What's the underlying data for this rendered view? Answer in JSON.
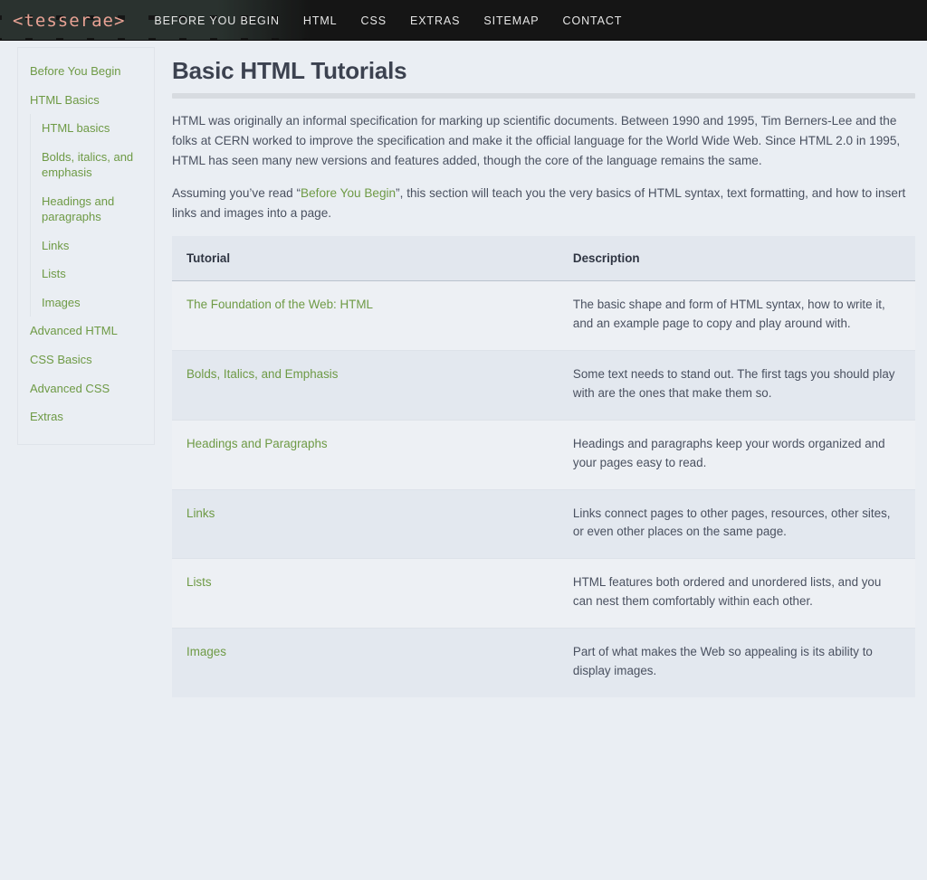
{
  "header": {
    "brand": "<tesserae>",
    "nav": [
      {
        "label": "BEFORE YOU BEGIN",
        "name": "nav-before-you-begin"
      },
      {
        "label": "HTML",
        "name": "nav-html"
      },
      {
        "label": "CSS",
        "name": "nav-css"
      },
      {
        "label": "EXTRAS",
        "name": "nav-extras"
      },
      {
        "label": "SITEMAP",
        "name": "nav-sitemap"
      },
      {
        "label": "CONTACT",
        "name": "nav-contact"
      }
    ]
  },
  "sidebar": {
    "items": [
      {
        "label": "Before You Begin"
      },
      {
        "label": "HTML Basics"
      },
      {
        "label": "Advanced HTML"
      },
      {
        "label": "CSS Basics"
      },
      {
        "label": "Advanced CSS"
      },
      {
        "label": "Extras"
      }
    ],
    "sub_items": [
      {
        "label": "HTML basics"
      },
      {
        "label": "Bolds, italics, and emphasis"
      },
      {
        "label": "Headings and paragraphs"
      },
      {
        "label": "Links"
      },
      {
        "label": "Lists"
      },
      {
        "label": "Images"
      }
    ]
  },
  "main": {
    "title": "Basic HTML Tutorials",
    "paragraph1": "HTML was originally an informal specification for marking up scientific documents. Between 1990 and 1995, Tim Berners-Lee and the folks at CERN worked to improve the specification and make it the official language for the World Wide Web. Since HTML 2.0 in 1995, HTML has seen many new versions and features added, though the core of the language remains the same.",
    "paragraph2_before": "Assuming you’ve read “",
    "paragraph2_link": "Before You Begin",
    "paragraph2_after": "”, this section will teach you the very basics of HTML syntax, text formatting, and how to insert links and images into a page.",
    "table": {
      "columns": [
        "Tutorial",
        "Description"
      ],
      "rows": [
        {
          "tutorial": "The Foundation of the Web: HTML",
          "description": "The basic shape and form of HTML syntax, how to write it, and an example page to copy and play around with."
        },
        {
          "tutorial": "Bolds, Italics, and Emphasis",
          "description": "Some text needs to stand out. The first tags you should play with are the ones that make them so."
        },
        {
          "tutorial": "Headings and Paragraphs",
          "description": "Headings and paragraphs keep your words organized and your pages easy to read."
        },
        {
          "tutorial": "Links",
          "description": "Links connect pages to other pages, resources, other sites, or even other places on the same page."
        },
        {
          "tutorial": "Lists",
          "description": "HTML features both ordered and unordered lists, and you can nest them comfortably within each other."
        },
        {
          "tutorial": "Images",
          "description": "Part of what makes the Web so appealing is its ability to display images."
        }
      ]
    }
  },
  "colors": {
    "header_bg": "#151515",
    "brand": "#e8a294",
    "link_green": "#6e9a45",
    "page_bg": "#eaeef3",
    "table_header_bg": "#e2e7ee",
    "row_odd": "#edf0f4",
    "row_even": "#e3e8ef",
    "title": "#3c4250"
  }
}
